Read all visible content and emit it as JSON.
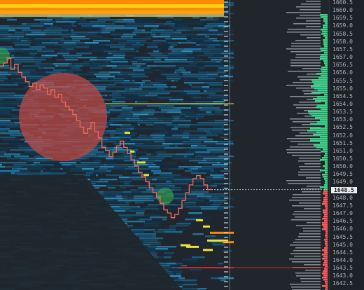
{
  "chart": {
    "current_price": "1648.5",
    "price_min": 1642.5,
    "price_max": 1660.5
  },
  "price_axis": {
    "ticks": [
      "1660.5",
      "1660.0",
      "1659.5",
      "1659.0",
      "1658.5",
      "1658.0",
      "1657.5",
      "1657.0",
      "1656.5",
      "1656.0",
      "1655.5",
      "1655.0",
      "1654.5",
      "1654.0",
      "1653.5",
      "1653.0",
      "1652.5",
      "1652.0",
      "1651.5",
      "1651.0",
      "1650.5",
      "1650.0",
      "1649.5",
      "1649.0",
      "1648.5",
      "1648.0",
      "1647.5",
      "1647.0",
      "1646.5",
      "1646.0",
      "1645.5",
      "1645.0",
      "1644.5",
      "1644.0",
      "1643.5",
      "1643.0",
      "1642.5"
    ]
  },
  "price_path": [
    [
      1656.4,
      1656.6,
      1656.9,
      1656.2,
      1656.5,
      1656.0,
      1655.7,
      1655.4,
      1655.1,
      1655.3,
      1654.9,
      1655.2,
      1655.0,
      1654.6,
      1654.9,
      1654.4,
      1654.6,
      1654.1,
      1653.8,
      1653.6,
      1653.3,
      1652.9,
      1652.5,
      1652.1,
      1652.4,
      1652.8,
      1652.2,
      1651.8,
      1651.2,
      1651.0,
      1650.6,
      1650.9,
      1651.3,
      1651.6,
      1651.2,
      1650.8,
      1650.4,
      1650.0,
      1649.6,
      1649.3,
      1649.0,
      1648.6,
      1648.3,
      1648.0,
      1647.6,
      1647.2,
      1647.0,
      1646.7,
      1646.9,
      1647.3,
      1647.8,
      1648.3,
      1648.8,
      1649.2,
      1649.4,
      1649.2,
      1648.8,
      1648.5
    ]
  ],
  "colors": {
    "price_line": "#e86a5c",
    "top_band_orange": "#ff8a00",
    "top_band_yellow": "#ffd21a",
    "yellow_level": "#e9e23a",
    "red_level": "#d62b2b",
    "circle_red": "#c24a44",
    "circle_green": "#3bb54a",
    "ask_profile": "#ff5a5a",
    "bid_profile": "#3ed38a"
  }
}
